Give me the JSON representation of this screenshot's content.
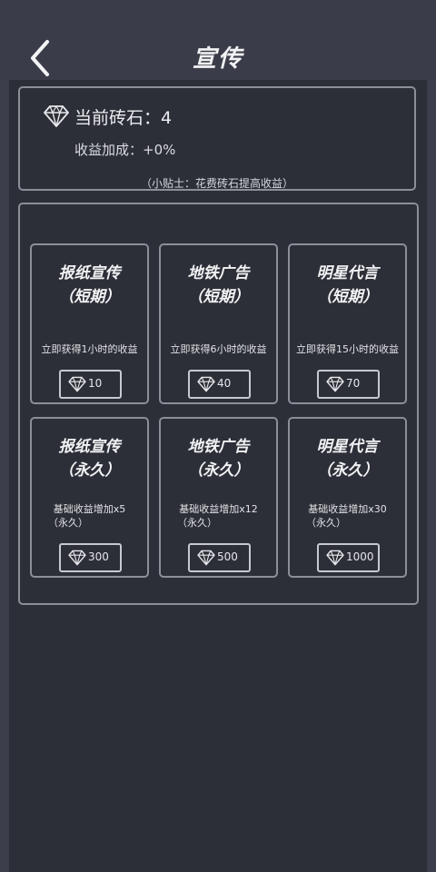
{
  "header": {
    "title": "宣传"
  },
  "info": {
    "stone_label": "当前砖石：4",
    "bonus_label": "收益加成：+0%",
    "tip": "（小贴士：花费砖石提高收益）"
  },
  "short_term": [
    {
      "title_line1": "报纸宣传",
      "title_line2": "（短期）",
      "desc": "立即获得1小时的收益",
      "price": "10"
    },
    {
      "title_line1": "地铁广告",
      "title_line2": "（短期）",
      "desc": "立即获得6小时的收益",
      "price": "40"
    },
    {
      "title_line1": "明星代言",
      "title_line2": "（短期）",
      "desc": "立即获得15小时的收益",
      "price": "70"
    }
  ],
  "permanent": [
    {
      "title_line1": "报纸宣传",
      "title_line2": "（永久）",
      "desc_line1": "基础收益增加x5",
      "desc_line2": "（永久）",
      "price": "300"
    },
    {
      "title_line1": "地铁广告",
      "title_line2": "（永久）",
      "desc_line1": "基础收益增加x12",
      "desc_line2": "（永久）",
      "price": "500"
    },
    {
      "title_line1": "明星代言",
      "title_line2": "（永久）",
      "desc_line1": "基础收益增加x30",
      "desc_line2": "（永久）",
      "price": "1000"
    }
  ],
  "icons": {
    "back": "chevron-left-icon",
    "gem": "diamond-icon"
  },
  "colors": {
    "background": "#3c3f4b",
    "panel": "#2c2f38",
    "border": "#8c8e98"
  }
}
